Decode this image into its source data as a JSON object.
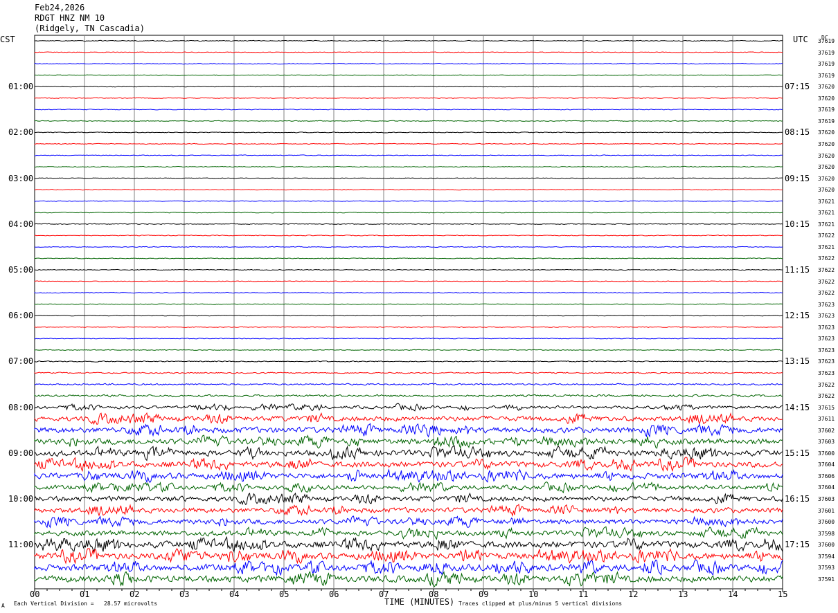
{
  "header": {
    "date": "Feb24,2026",
    "station": "RDGT HNZ NM 10",
    "location": "(Ridgely, TN Cascadia)"
  },
  "left_tz": "CST",
  "right_tz": "UTC",
  "dc_label": "DC",
  "footer": {
    "division": "Each Vertical Division =   28.57 microvolts",
    "clip": "Traces clipped at plus/minus 5 vertical divisions",
    "mark": "A"
  },
  "colors": {
    "trace_cycle": [
      "#000000",
      "#ff0000",
      "#0000ff",
      "#006400"
    ],
    "grid": "#808080"
  },
  "chart_data": {
    "type": "line",
    "xlabel": "TIME (MINUTES)",
    "xlim": [
      0,
      15
    ],
    "x_ticks": [
      "00",
      "01",
      "02",
      "03",
      "04",
      "05",
      "06",
      "07",
      "08",
      "09",
      "10",
      "11",
      "12",
      "13",
      "14",
      "15"
    ],
    "grid": true,
    "left_hour_labels": [
      "01:00",
      "02:00",
      "03:00",
      "04:00",
      "05:00",
      "06:00",
      "07:00",
      "08:00",
      "09:00",
      "10:00",
      "11:00"
    ],
    "right_hour_labels": [
      "07:15",
      "08:15",
      "09:15",
      "10:15",
      "11:15",
      "12:15",
      "13:15",
      "14:15",
      "15:15",
      "16:15",
      "17:15"
    ],
    "dc_offsets": [
      "37619",
      "37619",
      "37619",
      "37619",
      "37620",
      "37620",
      "37619",
      "37619",
      "37620",
      "37620",
      "37620",
      "37620",
      "37620",
      "37620",
      "37621",
      "37621",
      "37621",
      "37622",
      "37621",
      "37622",
      "37622",
      "37622",
      "37622",
      "37623",
      "37623",
      "37623",
      "37623",
      "37623",
      "37623",
      "37623",
      "37622",
      "37622",
      "37615",
      "37611",
      "37602",
      "37603",
      "37600",
      "37604",
      "37606",
      "37604",
      "37603",
      "37601",
      "37600",
      "37598",
      "37600",
      "37594",
      "37593",
      "37591"
    ],
    "activity_level": [
      1,
      1,
      1,
      1,
      1,
      1,
      1,
      1,
      1,
      1,
      1,
      1,
      1,
      1,
      1,
      1,
      1,
      1,
      1,
      1,
      1,
      1,
      1,
      1,
      1,
      1,
      1,
      1,
      1.2,
      1.3,
      1.6,
      2,
      2.5,
      4,
      4.5,
      4.5,
      4.5,
      4.5,
      4.5,
      3.5,
      4,
      4,
      4,
      4,
      5,
      5,
      5,
      5
    ]
  }
}
